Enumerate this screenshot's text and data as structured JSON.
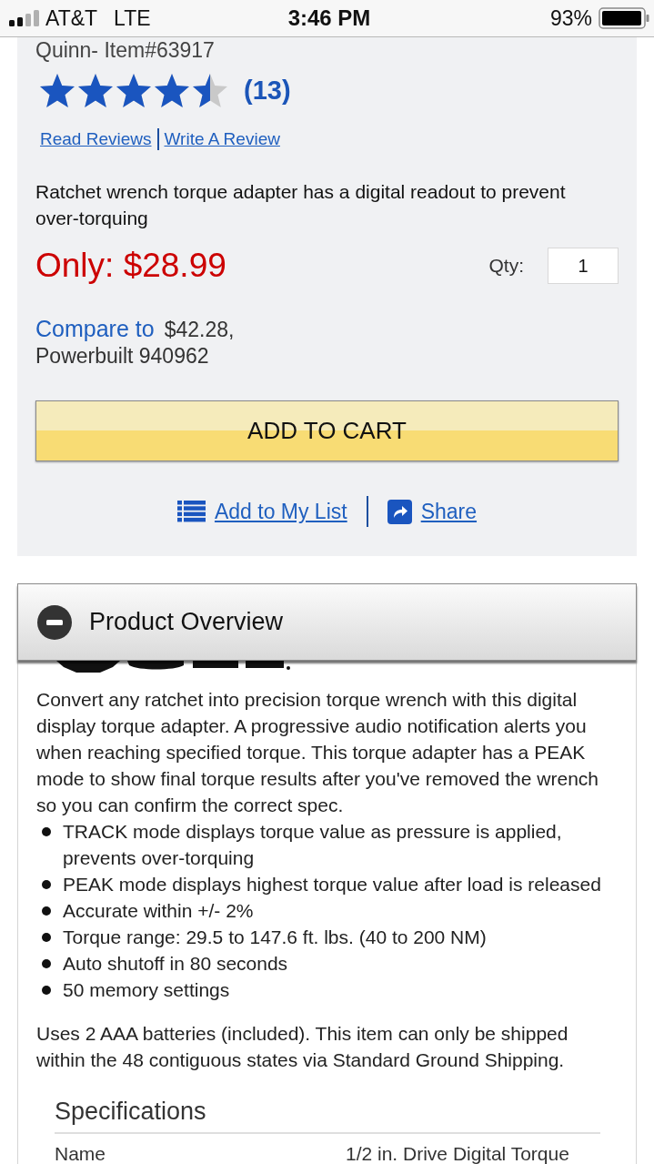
{
  "status_bar": {
    "carrier": "AT&T",
    "network": "LTE",
    "time": "3:46 PM",
    "battery": "93%"
  },
  "product": {
    "item_label": "Quinn- Item#63917",
    "rating": {
      "stars": 4.5,
      "count": "(13)"
    },
    "review_links": [
      "Read Reviews",
      "Write A Review"
    ],
    "description": "Ratchet wrench torque adapter has a digital readout to prevent over-torquing",
    "price": "Only: $28.99",
    "quantity": {
      "label": "Qty:",
      "value": "1"
    },
    "compare": {
      "label": "Compare to",
      "price": "$42.28,",
      "product": "Powerbuilt 940962"
    },
    "add_to_cart": "ADD TO CART",
    "actions": [
      {
        "kind": "list",
        "label": "Add to My List"
      },
      {
        "kind": "share",
        "label": "Share"
      }
    ]
  },
  "overview": {
    "title": "Product Overview",
    "expanded": true,
    "description": "Convert any ratchet into precision torque wrench with this digital display torque adapter. A progressive audio notification alerts you when reaching specified torque. This torque adapter has a PEAK mode to show final torque results after you've removed the wrench so you can confirm the correct spec.",
    "features": [
      "TRACK mode displays torque value as pressure is applied, prevents over-torquing",
      "PEAK mode displays highest torque value after load is released",
      "Accurate within +/- 2%",
      "Torque range: 29.5 to 147.6 ft. lbs. (40 to 200 NM)",
      "Auto shutoff in 80 seconds",
      "50 memory settings"
    ],
    "note": "Uses 2 AAA batteries (included). This item can only be shipped within the 48 contiguous states via Standard Ground Shipping.",
    "specifications": {
      "title": "Specifications",
      "rows": [
        {
          "name": "Name",
          "value": "1/2 in. Drive Digital Torque"
        }
      ]
    }
  }
}
